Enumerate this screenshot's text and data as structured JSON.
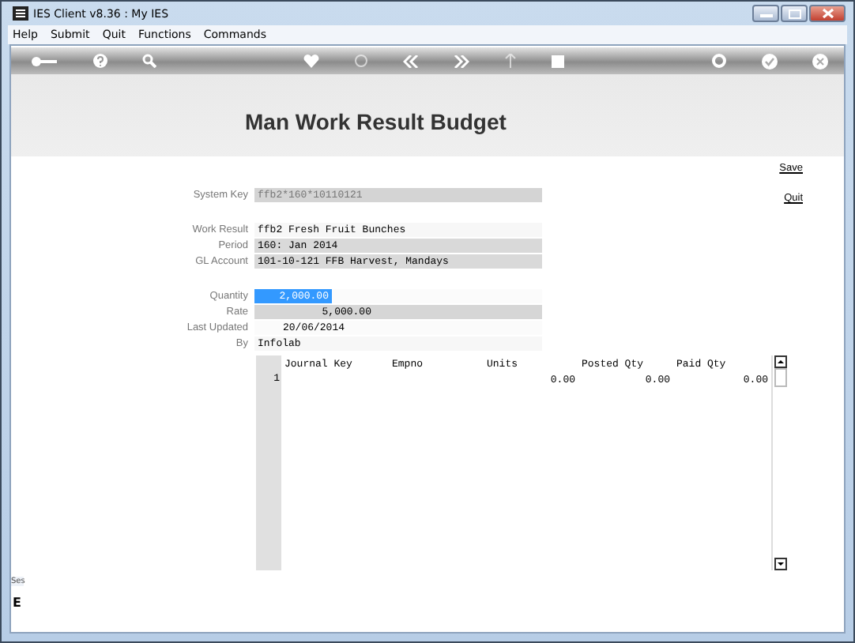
{
  "window": {
    "title": "IES Client v8.36 : My IES"
  },
  "menu": [
    "Help",
    "Submit",
    "Quit",
    "Functions",
    "Commands"
  ],
  "page_title": "Man Work Result Budget",
  "links": [
    "Save",
    "Quit"
  ],
  "field_groups": [
    [
      {
        "label": "System Key",
        "value": "ffb2*160*10110121",
        "kind": "key"
      }
    ],
    [
      {
        "label": "Work Result",
        "value": "ffb2 Fresh Fruit Bunches",
        "kind": "plain"
      },
      {
        "label": "Period",
        "value": "160: Jan 2014",
        "kind": "field"
      },
      {
        "label": "GL Account",
        "value": "101-10-121 FFB Harvest, Mandays",
        "kind": "field"
      }
    ],
    [
      {
        "label": "Quantity",
        "value": "2,000.00",
        "kind": "selected"
      },
      {
        "label": "Rate",
        "value": "5,000.00",
        "kind": "number"
      },
      {
        "label": "Last Updated",
        "value": "20/06/2014",
        "kind": "date"
      },
      {
        "label": "By",
        "value": "Infolab",
        "kind": "plain"
      }
    ]
  ],
  "table": {
    "columns": [
      "Journal Key",
      "Empno",
      "Units",
      "Posted Qty",
      "Paid Qty"
    ],
    "rows": [
      {
        "number": "1",
        "cells": [
          "",
          "",
          "0.00",
          "0.00",
          "0.00"
        ]
      }
    ]
  },
  "side_panel": {
    "label": "Ses",
    "letter": "E"
  }
}
